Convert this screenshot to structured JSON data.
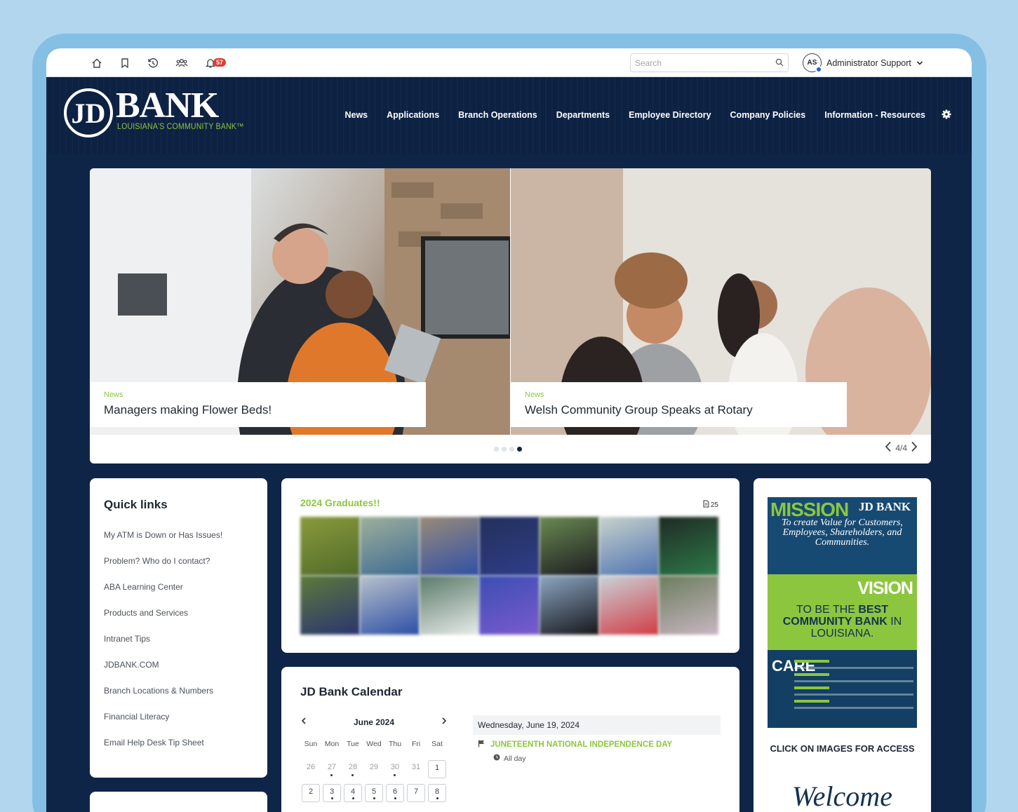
{
  "topbar": {
    "notification_count": "57",
    "search_placeholder": "Search",
    "user_initials": "AS",
    "user_name": "Administrator Support"
  },
  "header": {
    "logo_letters": "JD",
    "logo_word": "BANK",
    "logo_tagline": "LOUISIANA'S COMMUNITY BANK™",
    "nav": [
      "News",
      "Applications",
      "Branch Operations",
      "Departments",
      "Employee Directory",
      "Company Policies",
      "Information - Resources"
    ]
  },
  "carousel": {
    "slides": [
      {
        "category": "News",
        "title": "Managers making Flower Beds!"
      },
      {
        "category": "News",
        "title": "Welsh Community Group Speaks at Rotary"
      }
    ],
    "page_indicator": "4/4",
    "active_dot": 4,
    "dot_count": 4
  },
  "quick_links": {
    "title": "Quick links",
    "items": [
      "My ATM is Down or Has Issues!",
      "Problem? Who do I contact?",
      "ABA Learning Center",
      "Products and Services",
      "Intranet Tips",
      "JDBANK.COM",
      "Branch Locations & Numbers",
      "Financial Literacy",
      "Email Help Desk Tip Sheet"
    ]
  },
  "graduates": {
    "title": "2024 Graduates!!",
    "photo_count": "25"
  },
  "calendar": {
    "title": "JD Bank Calendar",
    "month": "June 2024",
    "weekdays": [
      "Sun",
      "Mon",
      "Tue",
      "Wed",
      "Thu",
      "Fri",
      "Sat"
    ],
    "week1": [
      "26",
      "27",
      "28",
      "29",
      "30",
      "31",
      "1"
    ],
    "week2": [
      "2",
      "3",
      "4",
      "5",
      "6",
      "7",
      "8"
    ],
    "selected_date": "Wednesday, June 19, 2024",
    "event_title": "JUNETEENTH NATIONAL INDEPENDENCE DAY",
    "event_time": "All day"
  },
  "mission_card": {
    "poster": {
      "mission_word": "MISSION",
      "brand": "JD BANK",
      "mission_text": "To create Value for Customers, Employees, Shareholders, and Communities.",
      "vision_word": "VISION",
      "vision_text_pre": "TO BE THE ",
      "vision_text_bold": "BEST COMMUNITY BANK",
      "vision_text_post": " IN LOUISIANA.",
      "care_letters": "CARE"
    },
    "caption": "CLICK ON IMAGES FOR ACCESS",
    "welcome": "Welcome"
  },
  "colors": {
    "page_bg": "#b1d6ee",
    "frame": "#86bfe4",
    "navy": "#0f2548",
    "accent_green": "#8cc63f",
    "badge_red": "#e23b2e"
  }
}
